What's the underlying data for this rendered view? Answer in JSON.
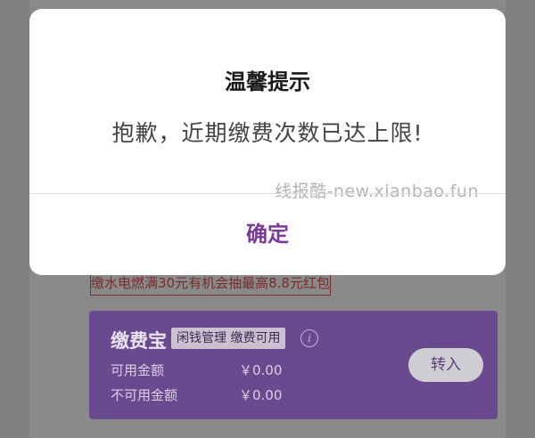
{
  "background": {
    "promo_text": "缴水电燃满30元有机会抽最高8.8元红包",
    "wallet": {
      "title": "缴费宝",
      "badge": "闲钱管理 缴费可用",
      "info_icon": "i",
      "available_label": "可用金额",
      "available_amount": "￥0.00",
      "unavailable_label": "不可用金额",
      "unavailable_amount": "￥0.00",
      "transfer_label": "转入"
    }
  },
  "dialog": {
    "title": "温馨提示",
    "message": "抱歉，近期缴费次数已达上限!",
    "watermark": "线报酷-new.xianbao.fun",
    "confirm_label": "确定"
  },
  "colors": {
    "accent": "#7a3a9a",
    "card": "#6a4a8f",
    "overlay": "#7f7f7f"
  }
}
